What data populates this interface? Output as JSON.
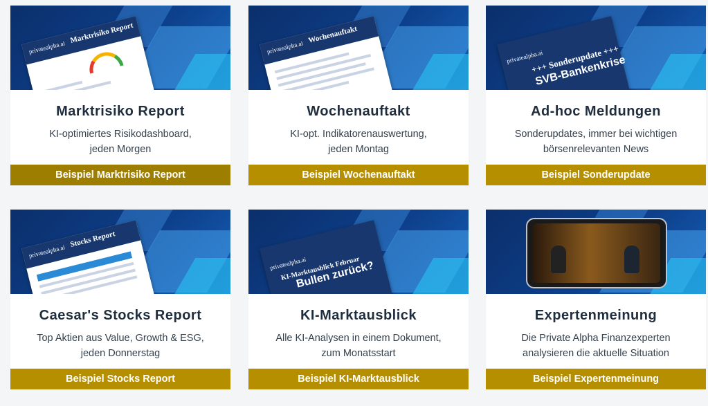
{
  "cards": [
    {
      "title": "Marktrisiko Report",
      "desc_line1": "KI-optimiertes Risikodashboard,",
      "desc_line2": "jeden Morgen",
      "button": "Beispiel Marktrisiko Report",
      "thumb_brand": "privatealpha.ai",
      "thumb_title": "Marktrisiko Report",
      "thumb_icon": "gauge-icon"
    },
    {
      "title": "Wochenauftakt",
      "desc_line1": "KI-opt. Indikatorenauswertung,",
      "desc_line2": "jeden Montag",
      "button": "Beispiel Wochenauftakt",
      "thumb_brand": "privatealpha.ai",
      "thumb_title": "Wochenauftakt",
      "thumb_icon": "document-icon"
    },
    {
      "title": "Ad-hoc Meldungen",
      "desc_line1": "Sonderupdates, immer bei wichtigen",
      "desc_line2": "börsenrelevanten News",
      "button": "Beispiel Sonderupdate",
      "thumb_brand": "privatealpha.ai",
      "thumb_title": "+++ Sonderupdate +++",
      "thumb_headline": "SVB-Bankenkrise",
      "thumb_icon": "document-icon"
    },
    {
      "title": "Caesar's Stocks Report",
      "desc_line1": "Top Aktien aus Value, Growth & ESG,",
      "desc_line2": "jeden Donnerstag",
      "button": "Beispiel Stocks Report",
      "thumb_brand": "privatealpha.ai",
      "thumb_title": "Stocks Report",
      "thumb_icon": "document-icon"
    },
    {
      "title": "KI-Marktausblick",
      "desc_line1": "Alle KI-Analysen in einem Dokument,",
      "desc_line2": "zum Monatsstart",
      "button": "Beispiel KI-Marktausblick",
      "thumb_brand": "privatealpha.ai",
      "thumb_title": "KI-Marktausblick Februar",
      "thumb_headline": "Bullen zurück?",
      "thumb_icon": "document-icon"
    },
    {
      "title": "Expertenmeinung",
      "desc_line1": "Die Private Alpha Finanzexperten",
      "desc_line2": "analysieren die aktuelle Situation",
      "button": "Beispiel Expertenmeinung",
      "thumb_icon": "smartphone-video-icon"
    }
  ],
  "colors": {
    "button_gold": "#b58f00",
    "thumb_blue": "#0d3f8a",
    "title_text": "#1f2d3d"
  }
}
